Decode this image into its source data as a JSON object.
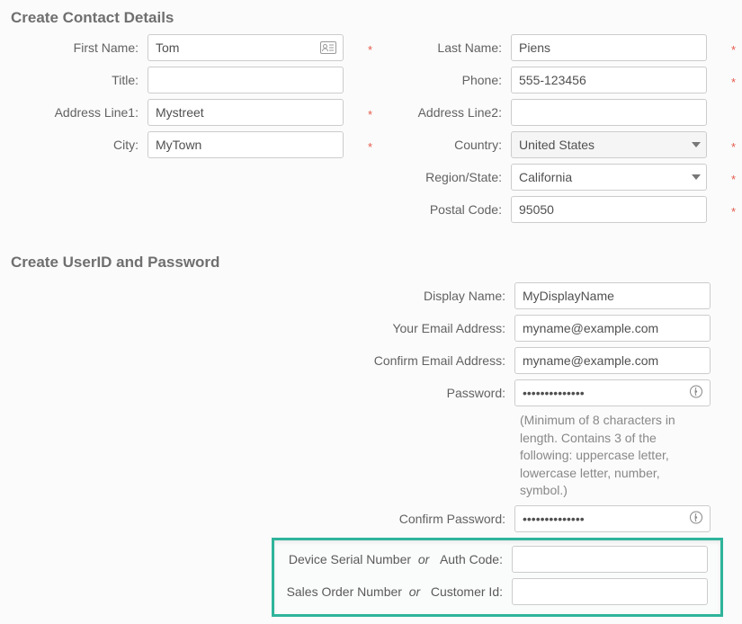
{
  "sections": {
    "contact_header": "Create Contact Details",
    "account_header": "Create UserID and Password"
  },
  "labels": {
    "first_name": "First Name:",
    "last_name": "Last Name:",
    "title": "Title:",
    "phone": "Phone:",
    "address1": "Address Line1:",
    "address2": "Address Line2:",
    "city": "City:",
    "country": "Country:",
    "region_state": "Region/State:",
    "postal_code": "Postal Code:",
    "display_name": "Display Name:",
    "email": "Your Email Address:",
    "confirm_email": "Confirm Email Address:",
    "password": "Password:",
    "confirm_password": "Confirm Password:",
    "device_serial": "Device Serial Number",
    "auth_code": "Auth Code:",
    "sales_order": "Sales Order Number",
    "customer_id": "Customer Id:",
    "or": "or"
  },
  "values": {
    "first_name": "Tom",
    "last_name": "Piens",
    "title": "",
    "phone": "555-123456",
    "address1": "Mystreet",
    "address2": "",
    "city": "MyTown",
    "country": "United States",
    "region_state": "California",
    "postal_code": "95050",
    "display_name": "MyDisplayName",
    "email": "myname@example.com",
    "confirm_email": "myname@example.com",
    "password": "••••••••••••••",
    "confirm_password": "••••••••••••••",
    "device_or_auth": "",
    "sales_or_customer": ""
  },
  "hints": {
    "password_rules": "(Minimum of 8 characters in length. Contains 3 of the following: uppercase letter, lowercase letter, number, symbol.)"
  },
  "required_mark": "*"
}
